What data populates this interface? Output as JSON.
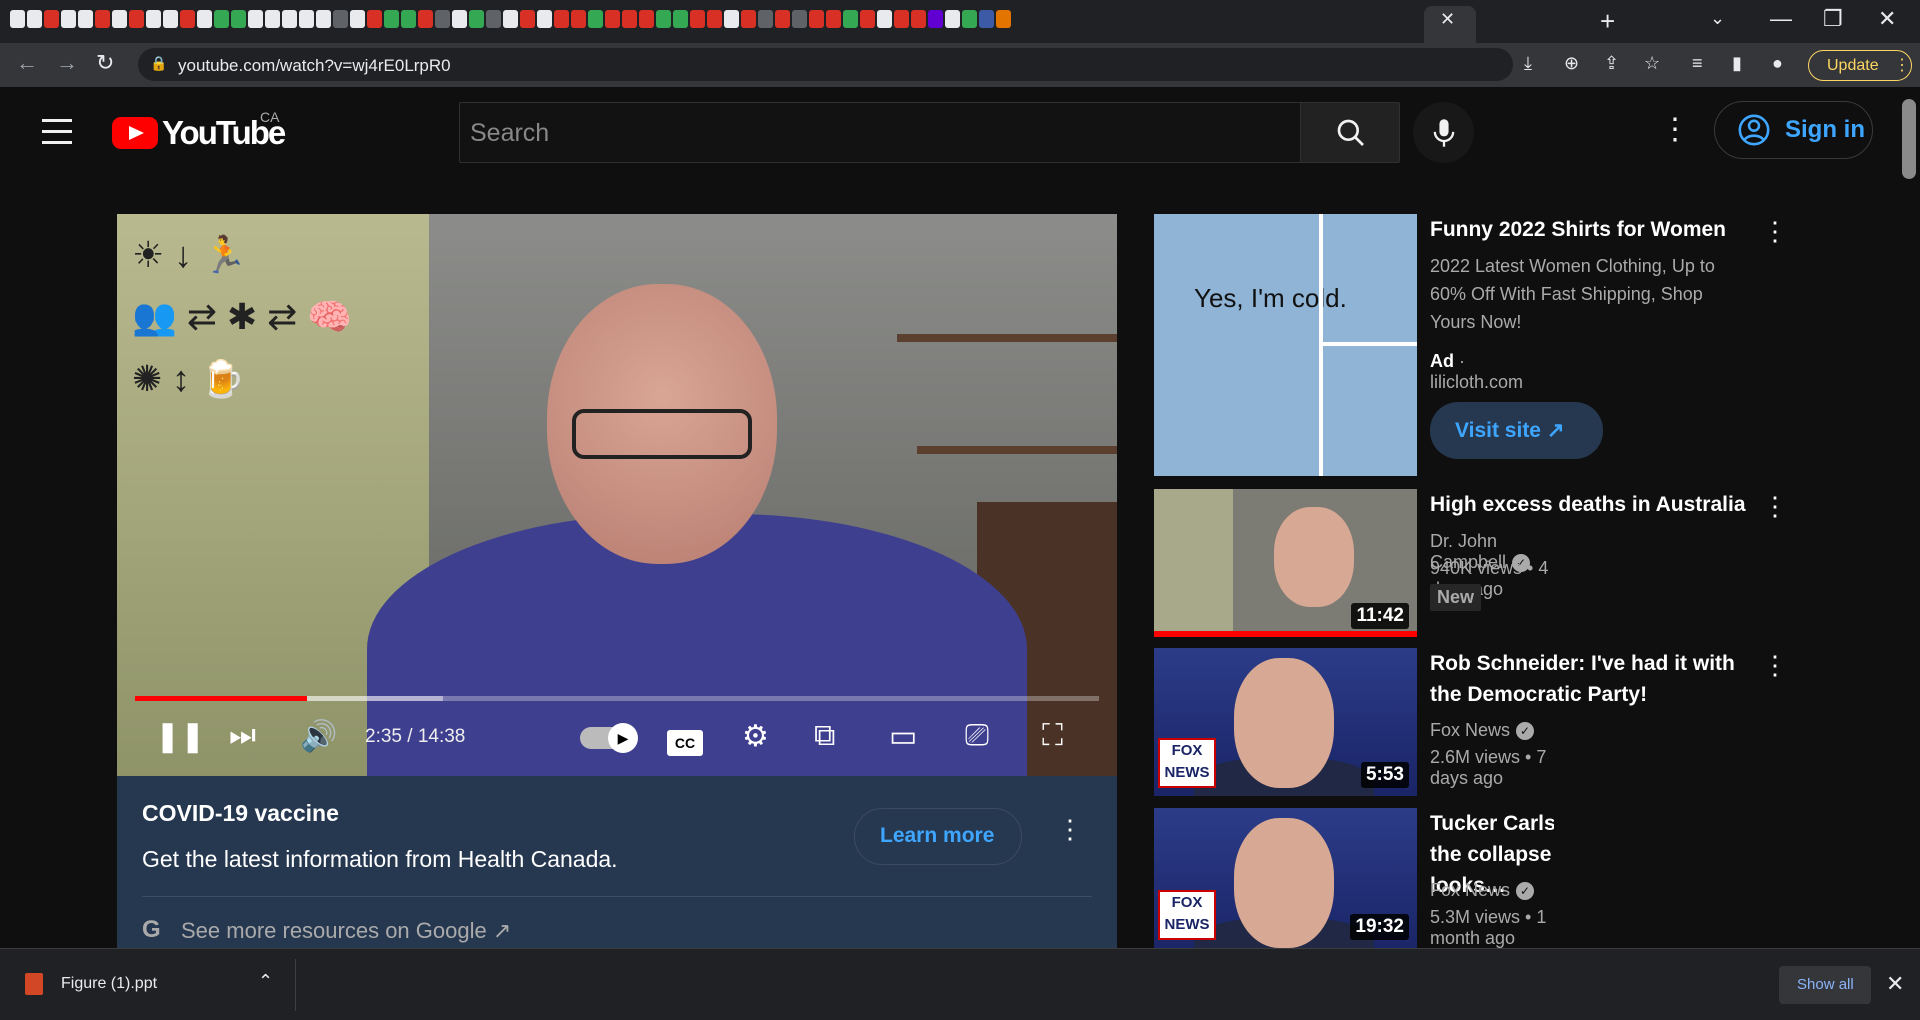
{
  "browser": {
    "url": "youtube.com/watch?v=wj4rE0LrpR0",
    "update_label": "Update",
    "tab_close": "✕",
    "new_tab": "+",
    "win_min": "—",
    "win_max": "❐",
    "win_close": "✕"
  },
  "masthead": {
    "logo_text": "YouTube",
    "region": "CA",
    "search_placeholder": "Search",
    "signin_label": "Sign in"
  },
  "player": {
    "time": "2:35 / 14:38",
    "played_fraction": 0.178,
    "buffered_fraction": 0.32,
    "cc_label": "CC"
  },
  "info_panel": {
    "title": "COVID-19 vaccine",
    "text": "Get the latest information from Health Canada.",
    "learn_more": "Learn more",
    "see_more": "See more resources on Google ↗"
  },
  "ad": {
    "title": "Funny 2022 Shirts for Women",
    "description": "2022 Latest Women Clothing, Up to 60% Off With Fast Shipping, Shop Yours Now!",
    "ad_label": "Ad",
    "domain": "lilicloth.com",
    "visit_label": "Visit site ↗",
    "thumb_text": "Yes, I'm cold."
  },
  "related": [
    {
      "title": "High excess deaths in Australia",
      "channel": "Dr. John Campbell",
      "stats": "940K views • 4 days ago",
      "badge": "New",
      "duration": "11:42"
    },
    {
      "title": "Rob Schneider: I've had it with the Democratic Party!",
      "channel": "Fox News",
      "stats": "2.6M views • 7 days ago",
      "duration": "5:53"
    },
    {
      "title": "Tucker Carlson: This is what the collapse of civilization looks…",
      "channel": "Fox News",
      "stats": "5.3M views • 1 month ago",
      "duration": "19:32"
    }
  ],
  "fox_logo": "FOX NEWS",
  "downloads": {
    "file_name": "Figure (1).ppt",
    "show_all": "Show all"
  }
}
